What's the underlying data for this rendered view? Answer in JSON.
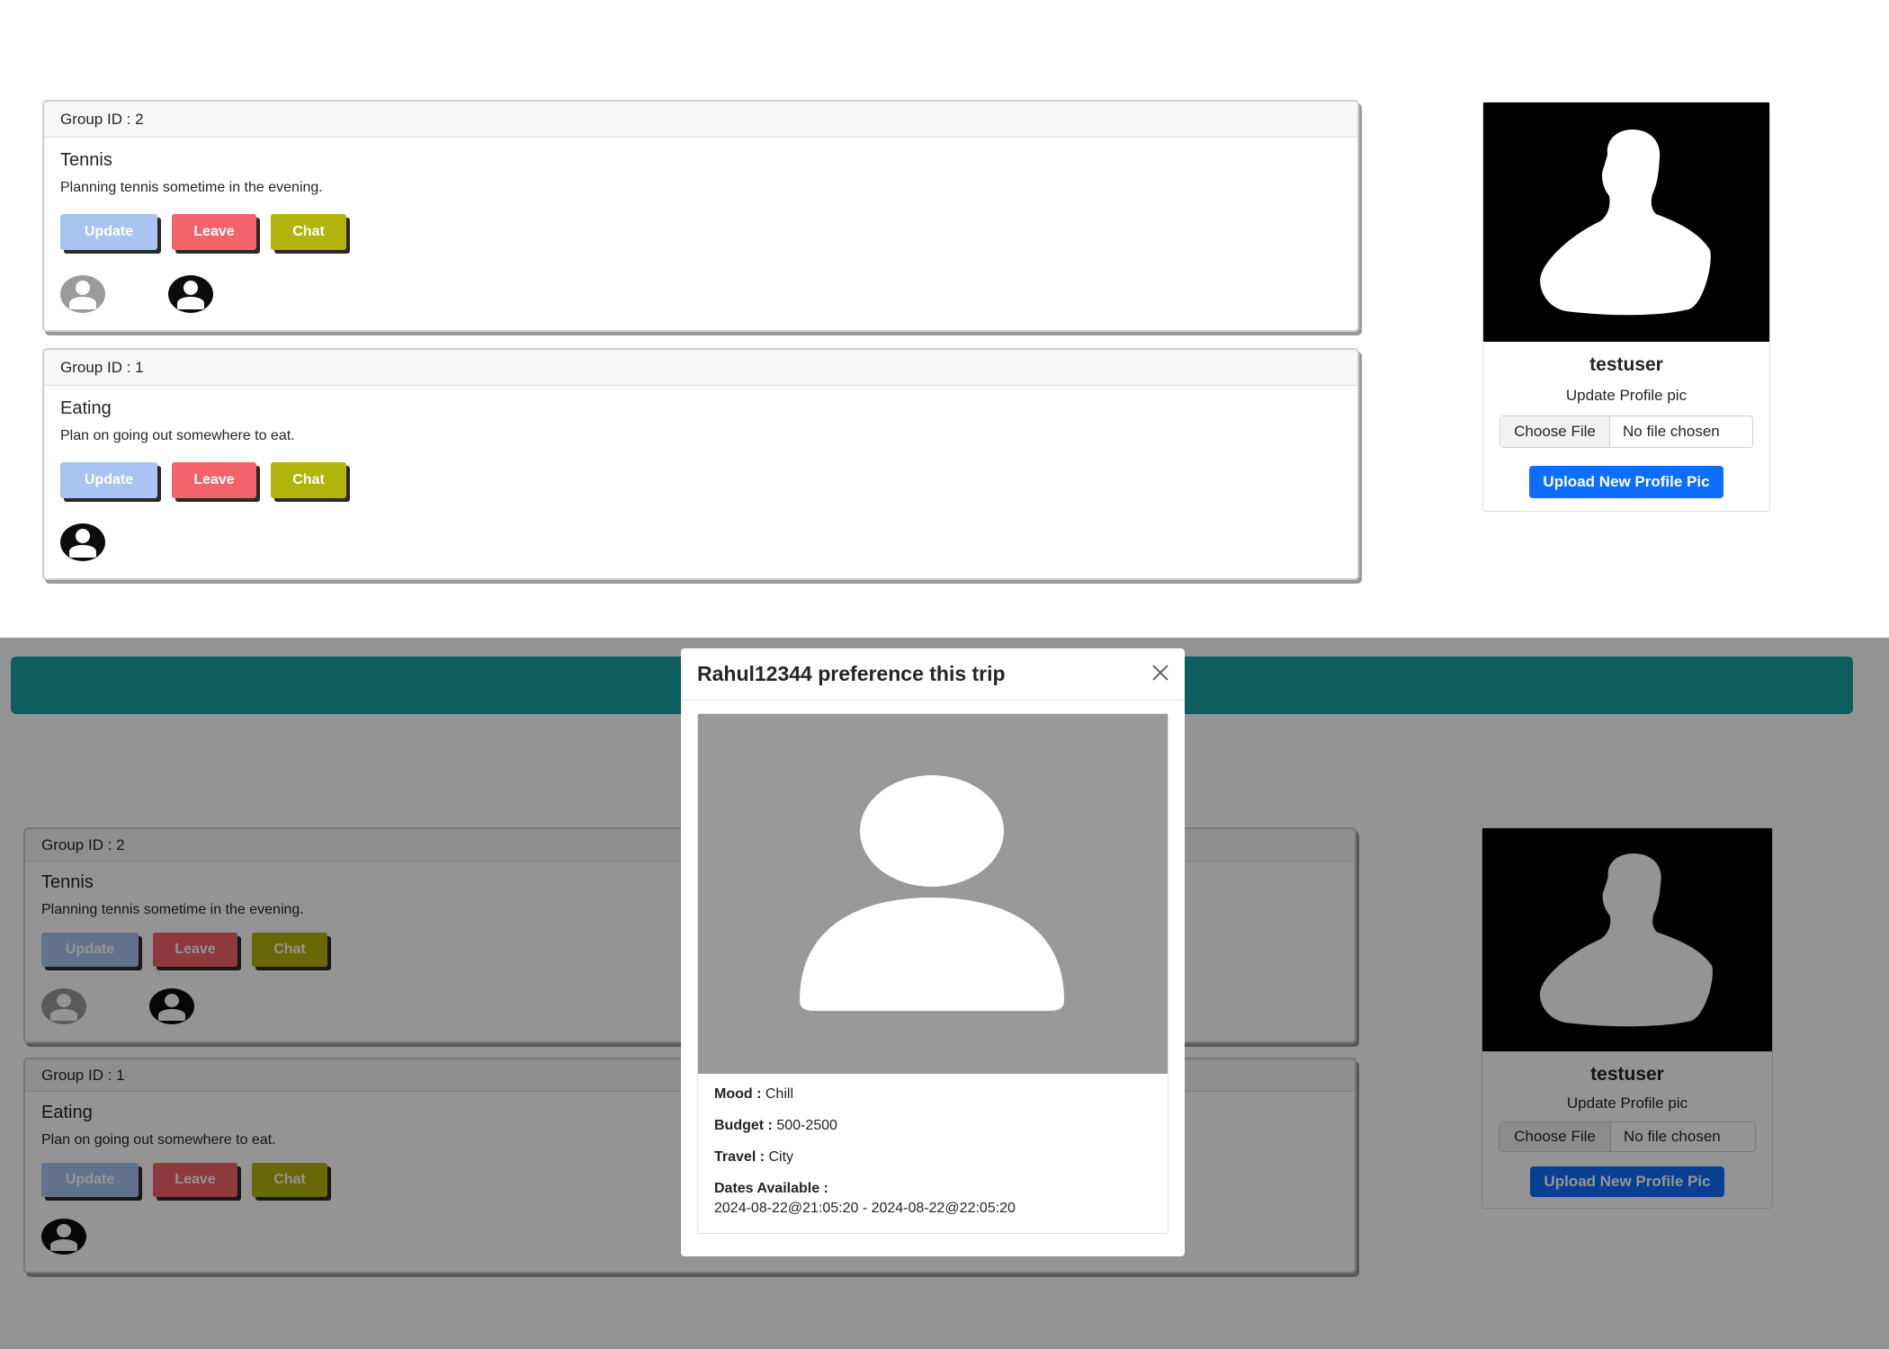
{
  "groups": [
    {
      "group_id_label": "Group ID : 2",
      "title": "Tennis",
      "description": "Planning tennis sometime in the evening.",
      "members": [
        "grey-user",
        "black-user"
      ]
    },
    {
      "group_id_label": "Group ID : 1",
      "title": "Eating",
      "description": "Plan on going out somewhere to eat.",
      "members": [
        "black-user"
      ]
    }
  ],
  "buttons": {
    "update": "Update",
    "leave": "Leave",
    "chat": "Chat"
  },
  "profile": {
    "username": "testuser",
    "update_label": "Update Profile pic",
    "choose_file": "Choose File",
    "no_file": "No file chosen",
    "upload_button": "Upload New Profile Pic"
  },
  "modal": {
    "title": "Rahul12344 preference this trip",
    "close_icon": "close-icon",
    "mood_label": "Mood :",
    "mood_value": "Chill",
    "budget_label": "Budget :",
    "budget_value": "500-2500",
    "travel_label": "Travel :",
    "travel_value": "City",
    "dates_label": "Dates Available :",
    "dates_value": "2024-08-22@21:05:20 - 2024-08-22@22:05:20"
  },
  "colors": {
    "update": "#a9c4f2",
    "leave": "#f3636a",
    "chat": "#b3b30e",
    "primary": "#0d6efd",
    "teal_bar": "#0e5e60"
  }
}
